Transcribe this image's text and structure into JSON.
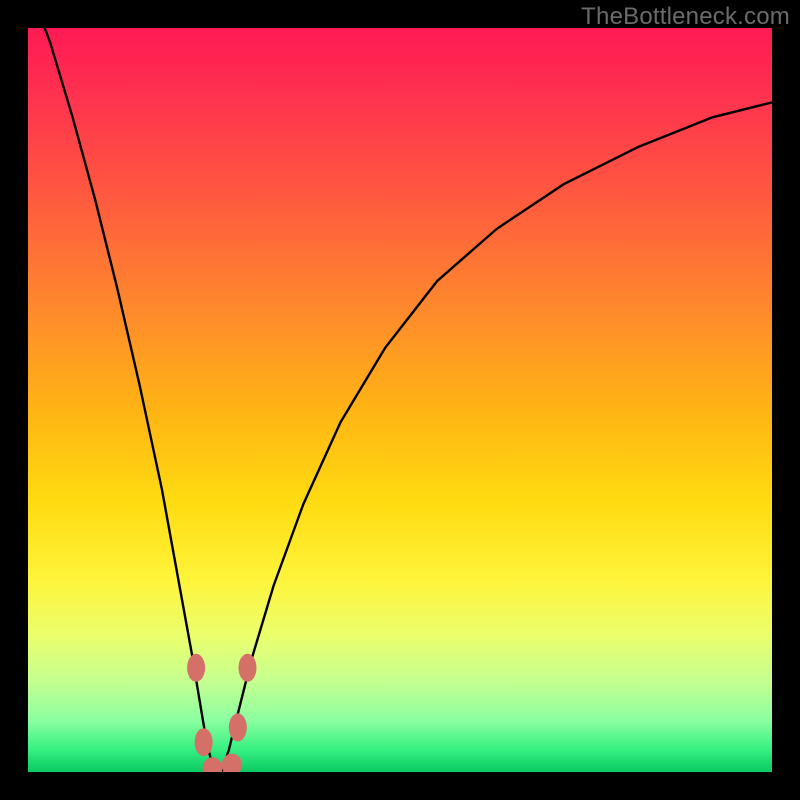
{
  "watermark": {
    "text": "TheBottleneck.com"
  },
  "colors": {
    "background": "#000000",
    "curve": "#000000",
    "dot_fill": "#d47068",
    "gradient_stops": [
      "#ff1a53",
      "#ff2f50",
      "#ff5740",
      "#ff8a2c",
      "#ffb613",
      "#ffdc12",
      "#fff43a",
      "#eaff6f",
      "#c3ff91",
      "#8cffa0",
      "#35f081",
      "#09c95f"
    ]
  },
  "chart_data": {
    "type": "line",
    "title": "",
    "xlabel": "",
    "ylabel": "",
    "xlim": [
      0,
      100
    ],
    "ylim": [
      0,
      100
    ],
    "grid": false,
    "legend": false,
    "note": "Performance-mismatch V-curve; y≈100 means severe bottleneck, y≈0 means balanced. Minimum at x≈25.",
    "series": [
      {
        "name": "bottleneck-curve",
        "x": [
          0,
          3,
          6,
          9,
          12,
          15,
          18,
          20,
          22,
          23,
          24,
          25,
          26,
          27,
          28,
          30,
          33,
          37,
          42,
          48,
          55,
          63,
          72,
          82,
          92,
          100
        ],
        "y": [
          106,
          98,
          88,
          77,
          65,
          52,
          38,
          27,
          16,
          10,
          4,
          0,
          0,
          3,
          7,
          15,
          25,
          36,
          47,
          57,
          66,
          73,
          79,
          84,
          88,
          90
        ]
      }
    ],
    "markers": [
      {
        "name": "left-upper-dot",
        "x": 22.6,
        "y": 14
      },
      {
        "name": "left-lower-dot",
        "x": 23.6,
        "y": 4
      },
      {
        "name": "trough-left-dot",
        "x": 24.8,
        "y": 0.5
      },
      {
        "name": "trough-right-dot",
        "x": 27.4,
        "y": 1
      },
      {
        "name": "right-lower-dot",
        "x": 28.2,
        "y": 6
      },
      {
        "name": "right-upper-dot",
        "x": 29.5,
        "y": 14
      }
    ]
  }
}
